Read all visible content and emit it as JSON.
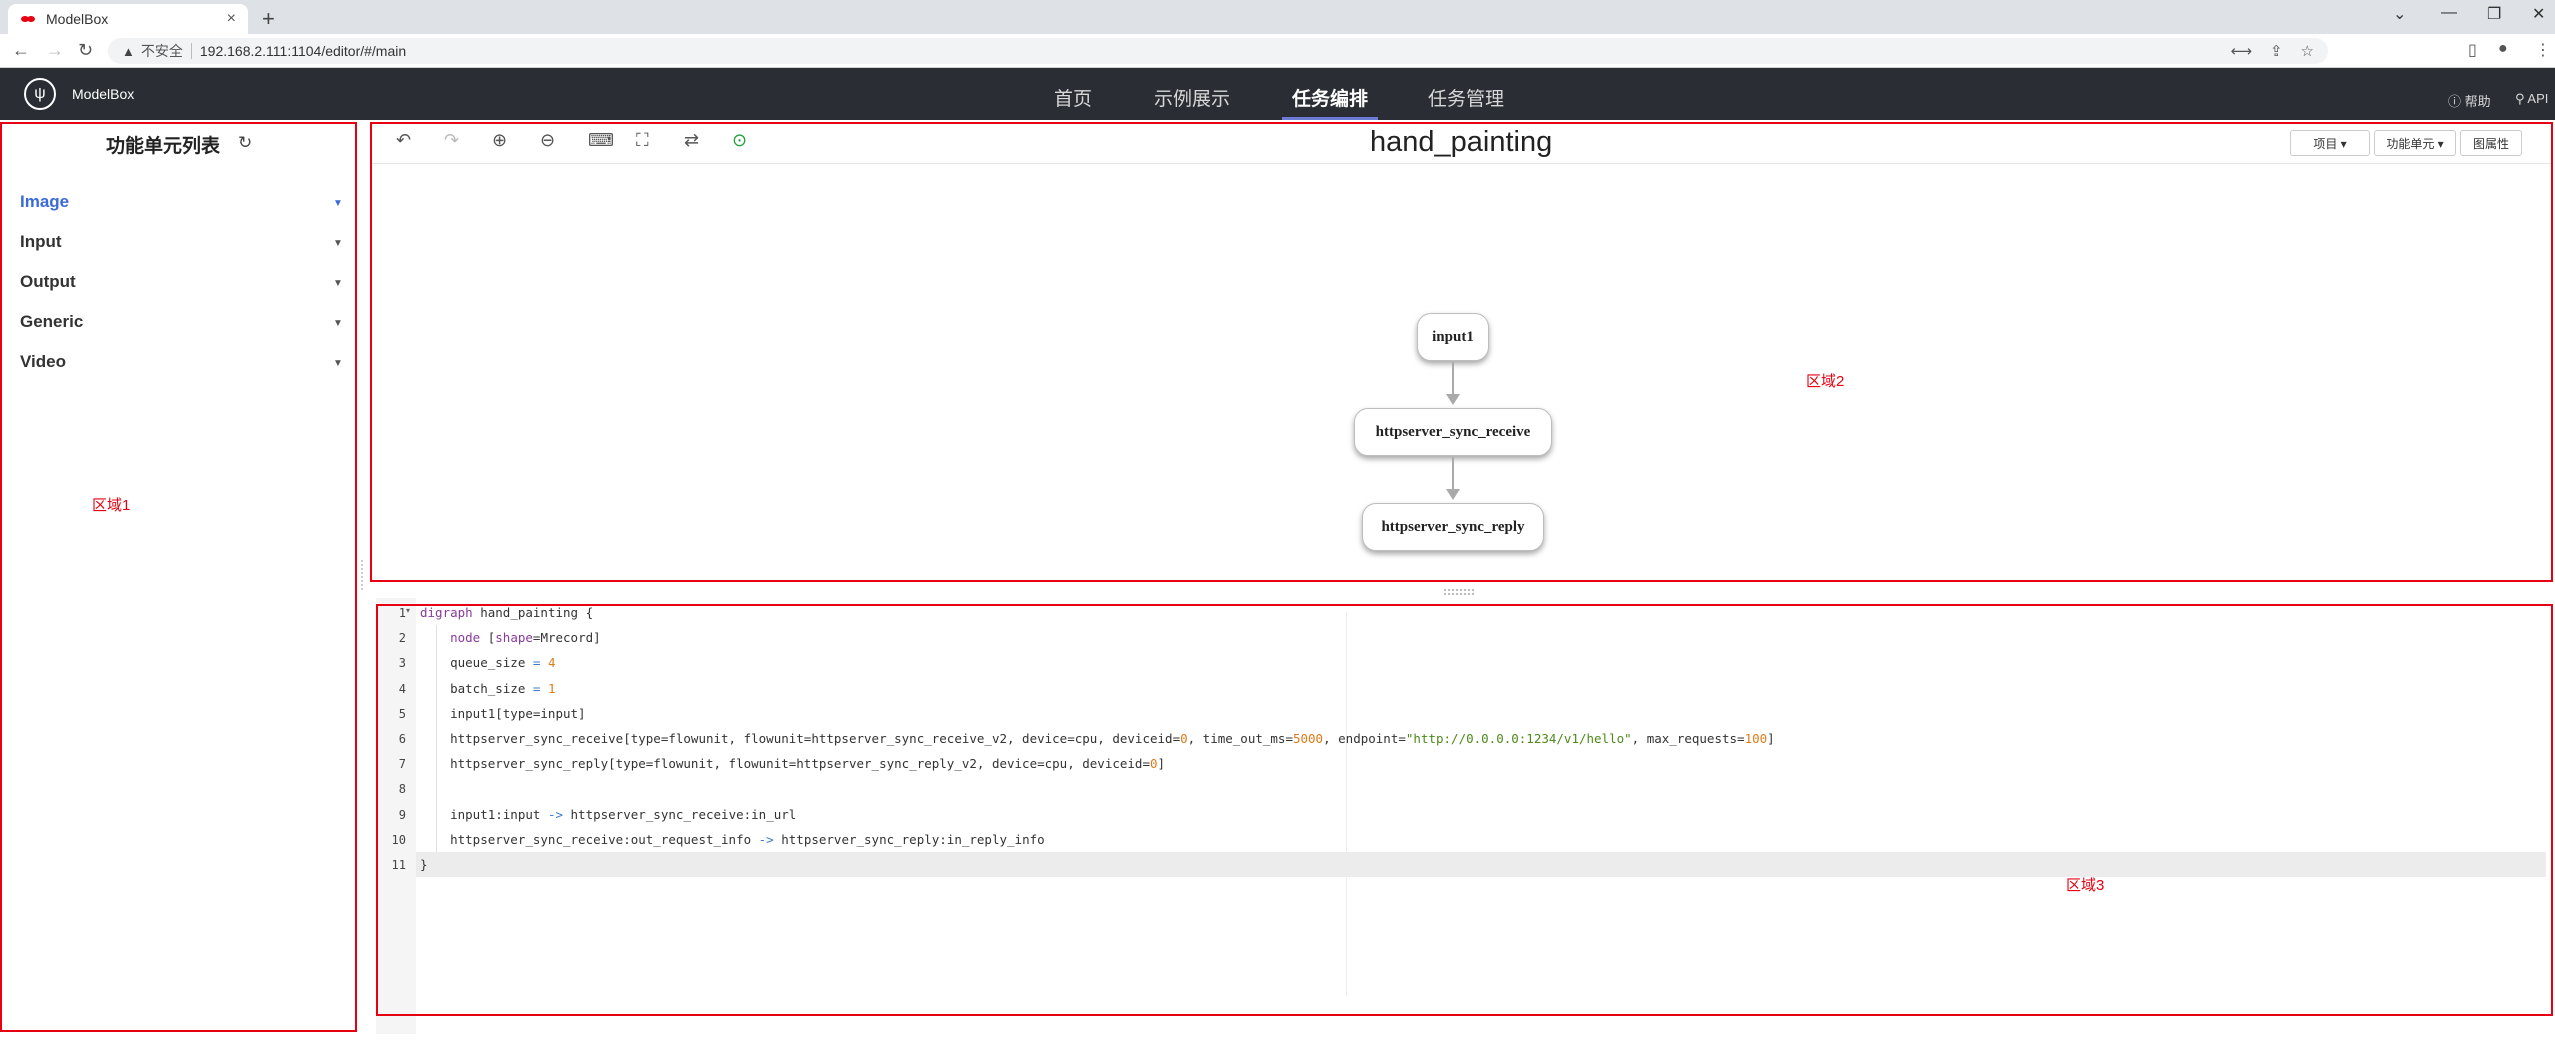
{
  "browser": {
    "tab_title": "ModelBox",
    "tab_close": "×",
    "new_tab": "+",
    "insecure_label": "不安全",
    "url": "192.168.2.111:1104/editor/#/main"
  },
  "app": {
    "brand": "ModelBox",
    "nav": [
      "首页",
      "示例展示",
      "任务编排",
      "任务管理"
    ],
    "active_nav": "任务编排",
    "help": "帮助",
    "api": "API"
  },
  "left_panel": {
    "title": "功能单元列表",
    "categories": [
      "Image",
      "Input",
      "Output",
      "Generic",
      "Video"
    ],
    "active_category": "Image",
    "region_label": "区域1"
  },
  "canvas": {
    "title": "hand_painting",
    "buttons": {
      "project": "项目 ▾",
      "flowunit": "功能单元 ▾",
      "graph_props": "图属性"
    },
    "nodes": [
      "input1",
      "httpserver_sync_receive",
      "httpserver_sync_reply"
    ],
    "region_label": "区域2"
  },
  "code_panel": {
    "region_label": "区域3",
    "line_numbers": [
      "1",
      "2",
      "3",
      "4",
      "5",
      "6",
      "7",
      "8",
      "9",
      "10",
      "11"
    ],
    "lines": [
      "digraph hand_painting {",
      "    node [shape=Mrecord]",
      "    queue_size = 4",
      "    batch_size = 1",
      "    input1[type=input]",
      "    httpserver_sync_receive[type=flowunit, flowunit=httpserver_sync_receive_v2, device=cpu, deviceid=0, time_out_ms=5000, endpoint=\"http://0.0.0.0:1234/v1/hello\", max_requests=100]",
      "    httpserver_sync_reply[type=flowunit, flowunit=httpserver_sync_reply_v2, device=cpu, deviceid=0]",
      "",
      "    input1:input -> httpserver_sync_receive:in_url",
      "    httpserver_sync_receive:out_request_info -> httpserver_sync_reply:in_reply_info",
      "}"
    ],
    "current_line": "11"
  },
  "colors": {
    "header_bg": "#2a2d34",
    "region_outline": "#e60012",
    "active_link": "#3a6bd6",
    "nav_underline": "#6b7bd6"
  }
}
